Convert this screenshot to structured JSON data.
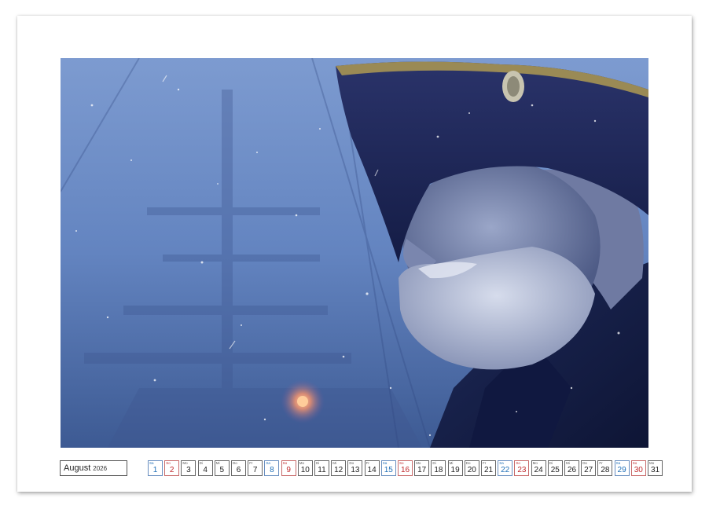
{
  "calendar": {
    "month": "August",
    "year": "2026",
    "days": [
      {
        "wd": "Sa",
        "num": "1",
        "type": "sat"
      },
      {
        "wd": "So",
        "num": "2",
        "type": "sun"
      },
      {
        "wd": "Mo",
        "num": "3",
        "type": "wk"
      },
      {
        "wd": "Di",
        "num": "4",
        "type": "wk"
      },
      {
        "wd": "Mi",
        "num": "5",
        "type": "wk"
      },
      {
        "wd": "Do",
        "num": "6",
        "type": "wk"
      },
      {
        "wd": "Fr",
        "num": "7",
        "type": "wk"
      },
      {
        "wd": "Sa",
        "num": "8",
        "type": "sat"
      },
      {
        "wd": "So",
        "num": "9",
        "type": "sun"
      },
      {
        "wd": "Mo",
        "num": "10",
        "type": "wk"
      },
      {
        "wd": "Di",
        "num": "11",
        "type": "wk"
      },
      {
        "wd": "Mi",
        "num": "12",
        "type": "wk"
      },
      {
        "wd": "Do",
        "num": "13",
        "type": "wk"
      },
      {
        "wd": "Fr",
        "num": "14",
        "type": "wk"
      },
      {
        "wd": "Sa",
        "num": "15",
        "type": "sat"
      },
      {
        "wd": "So",
        "num": "16",
        "type": "sun"
      },
      {
        "wd": "Mo",
        "num": "17",
        "type": "wk"
      },
      {
        "wd": "Di",
        "num": "18",
        "type": "wk"
      },
      {
        "wd": "Mi",
        "num": "19",
        "type": "wk"
      },
      {
        "wd": "Do",
        "num": "20",
        "type": "wk"
      },
      {
        "wd": "Fr",
        "num": "21",
        "type": "wk"
      },
      {
        "wd": "Sa",
        "num": "22",
        "type": "sat"
      },
      {
        "wd": "So",
        "num": "23",
        "type": "sun"
      },
      {
        "wd": "Mo",
        "num": "24",
        "type": "wk"
      },
      {
        "wd": "Di",
        "num": "25",
        "type": "wk"
      },
      {
        "wd": "Mi",
        "num": "26",
        "type": "wk"
      },
      {
        "wd": "Do",
        "num": "27",
        "type": "wk"
      },
      {
        "wd": "Fr",
        "num": "28",
        "type": "wk"
      },
      {
        "wd": "Sa",
        "num": "29",
        "type": "sat"
      },
      {
        "wd": "So",
        "num": "30",
        "type": "sun"
      },
      {
        "wd": "Mo",
        "num": "31",
        "type": "wk"
      }
    ]
  },
  "colors": {
    "saturday": "#1f6fb8",
    "sunday": "#c0282b",
    "sky": "#6e8ec4",
    "coat": "#1a2450"
  }
}
